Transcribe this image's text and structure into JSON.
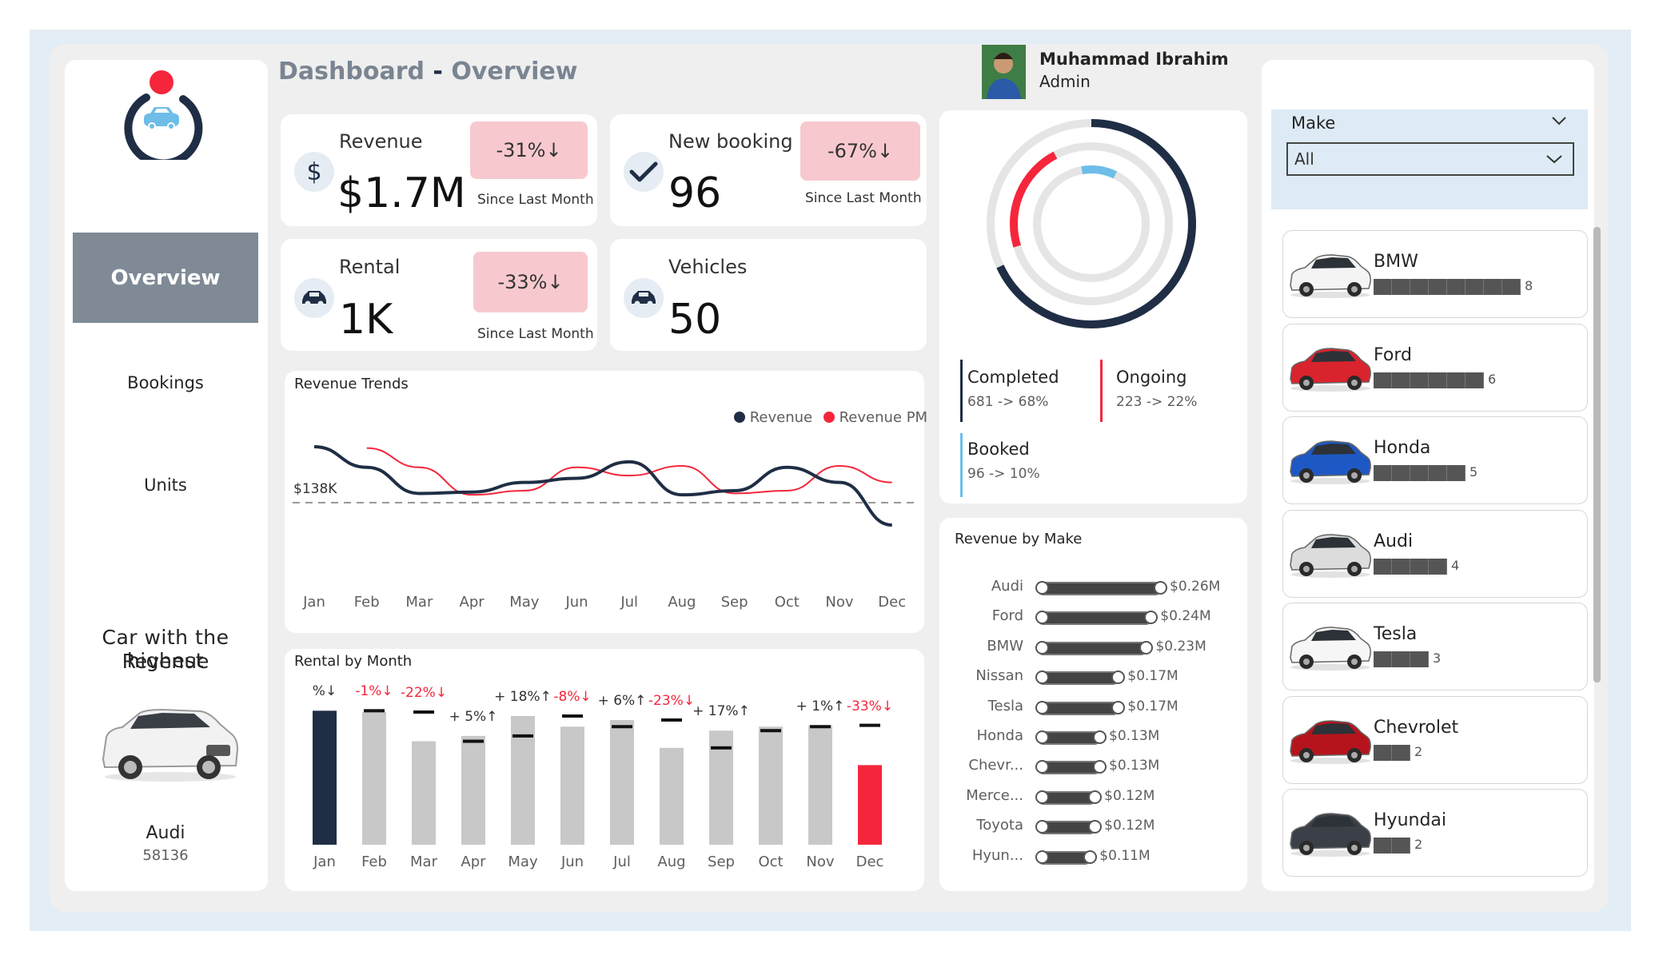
{
  "header": {
    "title_main": "Dashboard",
    "title_sep": "-",
    "title_sub": "Overview"
  },
  "user": {
    "name": "Muhammad Ibrahim",
    "role": "Admin"
  },
  "nav": {
    "overview": "Overview",
    "bookings": "Bookings",
    "units": "Units"
  },
  "highest": {
    "heading_line1": "Car with the highest",
    "heading_line2": "Revenue",
    "make": "Audi",
    "value": "58136"
  },
  "kpis": {
    "revenue": {
      "label": "Revenue",
      "value": "$1.7M",
      "change": "-31%",
      "arrow": "↓",
      "since": "Since Last Month",
      "icon": "$"
    },
    "booking": {
      "label": "New booking",
      "value": "96",
      "change": "-67%",
      "arrow": "↓",
      "since": "Since Last Month"
    },
    "rental": {
      "label": "Rental",
      "value": "1K",
      "change": "-33%",
      "arrow": "↓",
      "since": "Since Last Month"
    },
    "vehicles": {
      "label": "Vehicles",
      "value": "50"
    }
  },
  "status": {
    "completed": {
      "label": "Completed",
      "detail": "681 -> 68%"
    },
    "ongoing": {
      "label": "Ongoing",
      "detail": "223 -> 22%"
    },
    "booked": {
      "label": "Booked",
      "detail": "96 -> 10%"
    }
  },
  "filter": {
    "label": "Make",
    "value": "All"
  },
  "brands": [
    {
      "name": "BMW",
      "count": "8"
    },
    {
      "name": "Ford",
      "count": "6"
    },
    {
      "name": "Honda",
      "count": "5"
    },
    {
      "name": "Audi",
      "count": "4"
    },
    {
      "name": "Tesla",
      "count": "3"
    },
    {
      "name": "Chevrolet",
      "count": "2"
    },
    {
      "name": "Hyundai",
      "count": "2"
    }
  ],
  "colors": {
    "navy": "#1f2e45",
    "red": "#f5263c",
    "lightblue": "#6dbde8",
    "gray": "#c8c8c8",
    "badge": "#f7c9cf"
  },
  "chart_data": [
    {
      "type": "line",
      "title": "Revenue Trends",
      "reference_label": "$138K",
      "x": [
        "Jan",
        "Feb",
        "Mar",
        "Apr",
        "May",
        "Jun",
        "Jul",
        "Aug",
        "Sep",
        "Oct",
        "Nov",
        "Dec"
      ],
      "series": [
        {
          "name": "Revenue",
          "values": [
            157,
            142,
            123,
            124,
            131,
            134,
            146,
            122,
            125,
            142,
            131,
            100
          ]
        },
        {
          "name": "Revenue PM",
          "values": [
            null,
            156,
            142,
            122,
            125,
            142,
            136,
            143,
            123,
            125,
            143,
            131
          ]
        }
      ],
      "legend": "top-right"
    },
    {
      "type": "bar",
      "title": "Rental by Month",
      "categories": [
        "Jan",
        "Feb",
        "Mar",
        "Apr",
        "May",
        "Jun",
        "Jul",
        "Aug",
        "Sep",
        "Oct",
        "Nov",
        "Dec"
      ],
      "values": [
        101,
        100,
        78,
        82,
        97,
        89,
        94,
        73,
        86,
        89,
        90,
        60
      ],
      "previous": [
        null,
        101,
        100,
        78,
        82,
        97,
        89,
        94,
        73,
        86,
        89,
        90
      ],
      "labels": [
        "%↓",
        "-1%↓",
        "-22%↓",
        "+ 5%↑",
        "+ 18%↑",
        "-8%↓",
        "+ 6%↑",
        "-23%↓",
        "+ 17%↑",
        "",
        "+ 1%↑",
        "-33%↓"
      ],
      "ylim": [
        0,
        120
      ]
    },
    {
      "type": "bar",
      "title": "Revenue by Make",
      "categories": [
        "Audi",
        "Ford",
        "BMW",
        "Nissan",
        "Tesla",
        "Honda",
        "Chevr...",
        "Merce...",
        "Toyota",
        "Hyun..."
      ],
      "values": [
        0.26,
        0.24,
        0.23,
        0.17,
        0.17,
        0.13,
        0.13,
        0.12,
        0.12,
        0.11
      ],
      "value_labels": [
        "$0.26M",
        "$0.24M",
        "$0.23M",
        "$0.17M",
        "$0.17M",
        "$0.13M",
        "$0.13M",
        "$0.12M",
        "$0.12M",
        "$0.11M"
      ]
    },
    {
      "type": "pie",
      "title": "",
      "categories": [
        "Completed",
        "Ongoing",
        "Booked"
      ],
      "values": [
        68,
        22,
        10
      ]
    }
  ]
}
